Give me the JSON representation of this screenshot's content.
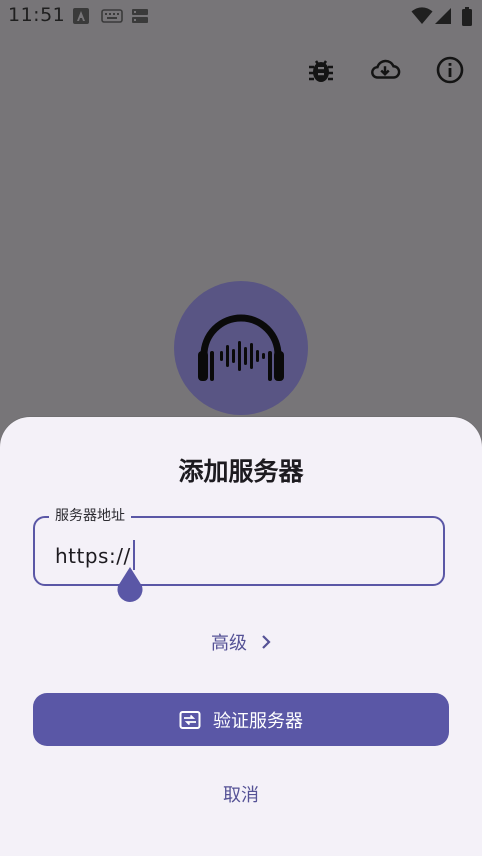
{
  "status_bar": {
    "time": "11:51"
  },
  "toolbar": {
    "icons": [
      "bug-icon",
      "cloud-download-icon",
      "info-icon"
    ]
  },
  "dialog": {
    "title": "添加服务器",
    "server_address": {
      "label": "服务器地址",
      "value": "https://"
    },
    "advanced_label": "高级",
    "verify_label": "验证服务器",
    "cancel_label": "取消"
  },
  "colors": {
    "accent": "#5a57a6",
    "scrim": "#777578",
    "sheet_background": "#f4f1f8",
    "avatar_background": "#595584"
  }
}
